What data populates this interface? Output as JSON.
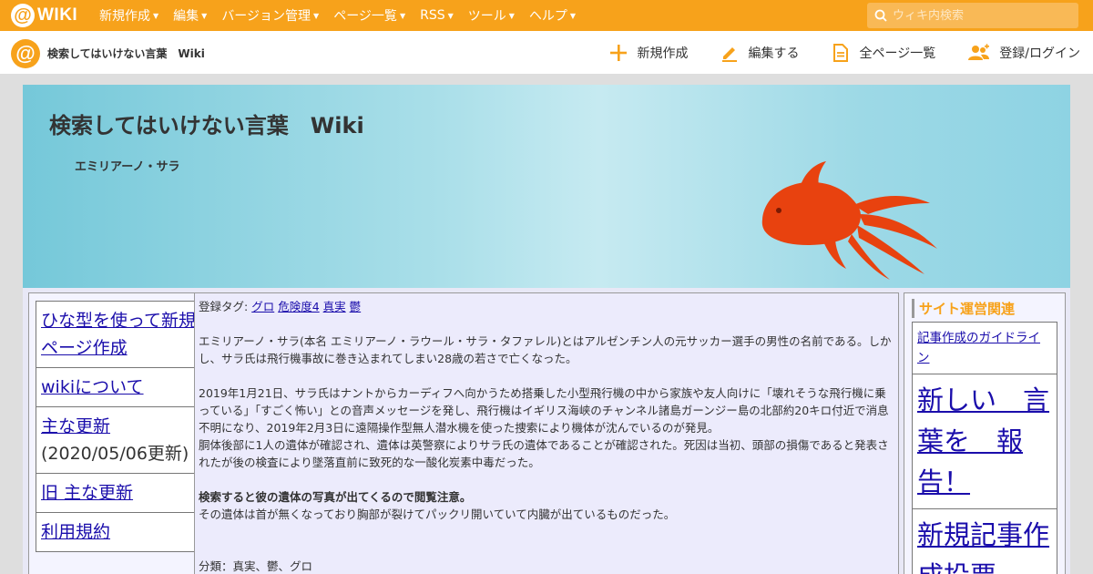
{
  "topbar": {
    "logo_text": "WIKI",
    "menu": [
      {
        "label": "新規作成"
      },
      {
        "label": "編集"
      },
      {
        "label": "バージョン管理"
      },
      {
        "label": "ページ一覧"
      },
      {
        "label": "RSS"
      },
      {
        "label": "ツール"
      },
      {
        "label": "ヘルプ"
      }
    ],
    "search_placeholder": "ウィキ内検索"
  },
  "subbar": {
    "site_title": "検索してはいけない言葉　Wiki",
    "actions": [
      {
        "label": "新規作成",
        "icon": "plus-icon"
      },
      {
        "label": "編集する",
        "icon": "pencil-icon"
      },
      {
        "label": "全ページ一覧",
        "icon": "document-icon"
      },
      {
        "label": "登録/ログイン",
        "icon": "users-icon"
      }
    ]
  },
  "banner": {
    "title": "検索してはいけない言葉　Wiki",
    "subtitle": "エミリアーノ・サラ"
  },
  "left_menu": {
    "items": [
      {
        "label": "ひな型を使って新規ページ作成",
        "note": ""
      },
      {
        "label": "wikiについて",
        "note": ""
      },
      {
        "label": "主な更新",
        "note": "(2020/05/06更新)"
      },
      {
        "label": "旧 主な更新",
        "note": ""
      },
      {
        "label": "利用規約",
        "note": ""
      }
    ]
  },
  "article": {
    "tags_label": "登録タグ:",
    "tags": [
      "グロ",
      "危険度4",
      "真実",
      "鬱"
    ],
    "intro": "エミリアーノ・サラ(本名 エミリアーノ・ラウール・サラ・タファレル)とはアルゼンチン人の元サッカー選手の男性の名前である。しかし、サラ氏は飛行機事故に巻き込まれてしまい28歳の若さで亡くなった。",
    "para1": "2019年1月21日、サラ氏はナントからカーディフへ向かうため搭乗した小型飛行機の中から家族や友人向けに「壊れそうな飛行機に乗っている」「すごく怖い」との音声メッセージを発し、飛行機はイギリス海峡のチャンネル諸島ガーンジー島の北部約20キロ付近で消息不明になり、2019年2月3日に遠隔操作型無人潜水機を使った捜索により機体が沈んでいるのが発見。",
    "para2": "胴体後部に1人の遺体が確認され、遺体は英警察によりサラ氏の遺体であることが確認された。死因は当初、頭部の損傷であると発表されたが後の検査により墜落直前に致死的な一酸化炭素中毒だった。",
    "warning": "検索すると彼の遺体の写真が出てくるので閲覧注意。",
    "warning_detail": "その遺体は首が無くなっており胸部が裂けてパックリ開いていて内臓が出ているものだった。",
    "category": "分類：真実、鬱、グロ"
  },
  "right_menu": {
    "heading": "サイト運営関連",
    "items": [
      {
        "label": "記事作成のガイドライン",
        "size": "small"
      },
      {
        "label": "新しい　言葉を　報告！",
        "size": "big"
      },
      {
        "label": "新規記事作成投票",
        "size": "big"
      }
    ]
  },
  "colors": {
    "accent": "#f7a21b",
    "link": "#1a0dab",
    "goldfish": "#e8420f"
  }
}
